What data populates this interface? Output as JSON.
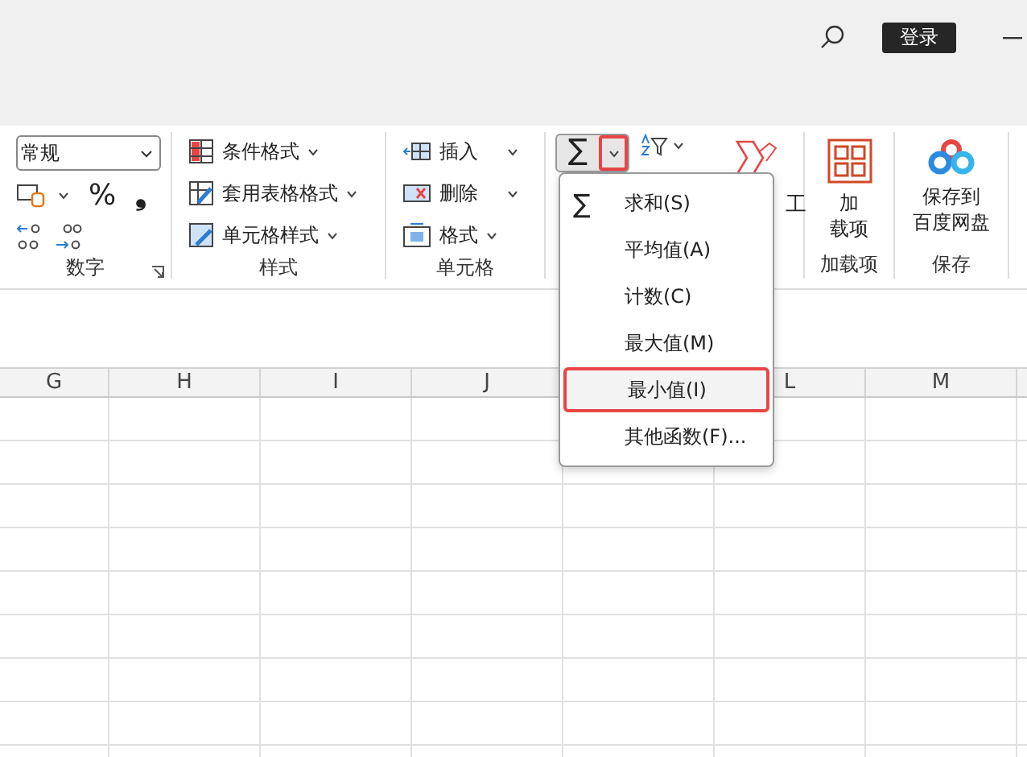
{
  "titlebar": {
    "login_button": "登录"
  },
  "ribbon": {
    "number_group": {
      "format_value": "常规",
      "percent": "%",
      "comma": "❟",
      "label": "数字"
    },
    "styles_group": {
      "items": [
        {
          "label": "条件格式"
        },
        {
          "label": "套用表格格式"
        },
        {
          "label": "单元格样式"
        }
      ],
      "label": "样式"
    },
    "cells_group": {
      "items": [
        {
          "label": "插入"
        },
        {
          "label": "删除"
        },
        {
          "label": "格式"
        }
      ],
      "label": "单元格"
    },
    "editing_group": {
      "sum_symbol": "∑",
      "sum_caret_highlighted": true
    },
    "partial_group": {
      "text": "工"
    },
    "addins_group": {
      "button_lines": [
        "加",
        "载项"
      ],
      "label": "加载项"
    },
    "save_group": {
      "button_lines": [
        "保存到",
        "百度网盘"
      ],
      "label": "保存"
    }
  },
  "columns": [
    {
      "label": "G"
    },
    {
      "label": "H"
    },
    {
      "label": "I"
    },
    {
      "label": "J"
    },
    {},
    {
      "label": "L"
    },
    {
      "label": "M"
    }
  ],
  "autosum_menu": [
    {
      "label": "求和(S)",
      "symbol": "∑",
      "highlighted": false
    },
    {
      "label": "平均值(A)",
      "highlighted": false
    },
    {
      "label": "计数(C)",
      "highlighted": false
    },
    {
      "label": "最大值(M)",
      "highlighted": false
    },
    {
      "label": "最小值(I)",
      "highlighted": true
    },
    {
      "label": "其他函数(F)...",
      "highlighted": false
    }
  ]
}
